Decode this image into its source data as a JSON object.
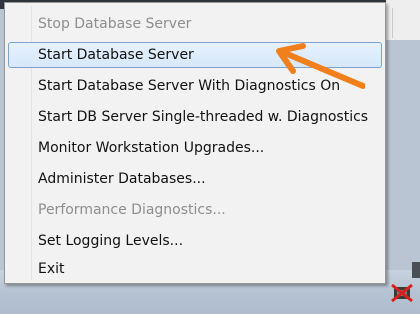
{
  "context_menu": {
    "items": [
      {
        "label": "Stop Database Server",
        "enabled": false
      },
      {
        "label": "Start Database Server",
        "enabled": true,
        "highlighted": true
      },
      {
        "label": "Start Database Server With Diagnostics On",
        "enabled": true
      },
      {
        "label": "Start DB Server Single-threaded w. Diagnostics",
        "enabled": true
      },
      {
        "label": "Monitor Workstation Upgrades...",
        "enabled": true
      },
      {
        "label": "Administer Databases...",
        "enabled": true
      },
      {
        "label": "Performance Diagnostics...",
        "enabled": false
      },
      {
        "label": "Set Logging Levels...",
        "enabled": true
      },
      {
        "label": "Exit",
        "enabled": true
      }
    ]
  },
  "annotation": {
    "type": "arrow",
    "color": "#f07f1c",
    "points_to": "Start Database Server"
  },
  "tray": {
    "icon": "database-server-stopped-icon",
    "color": "#cc2020"
  }
}
